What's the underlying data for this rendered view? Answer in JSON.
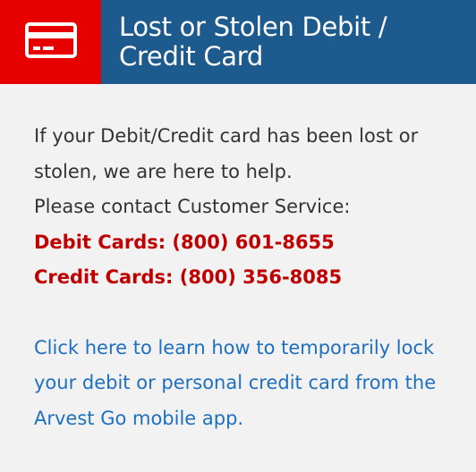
{
  "header": {
    "icon": "credit-card-icon",
    "title": "Lost or Stolen Debit /\nCredit Card",
    "colors": {
      "icon_bg": "#e60000",
      "title_bg": "#1d5a8e",
      "title_text": "#ffffff"
    }
  },
  "content": {
    "intro": "If your Debit/Credit card has been lost or stolen, we are here to help.",
    "contact": "Please contact Customer Service:",
    "debit_phone": "Debit Cards: (800) 601-8655",
    "credit_phone": "Credit Cards: (800) 356-8085",
    "link_text": "Click here to learn how to temporarily lock your debit or personal credit card from the Arvest Go mobile app.",
    "colors": {
      "phone": "#c00000",
      "link": "#1e6fbf",
      "body_text": "#333333",
      "panel_bg": "#f2f2f2"
    }
  }
}
